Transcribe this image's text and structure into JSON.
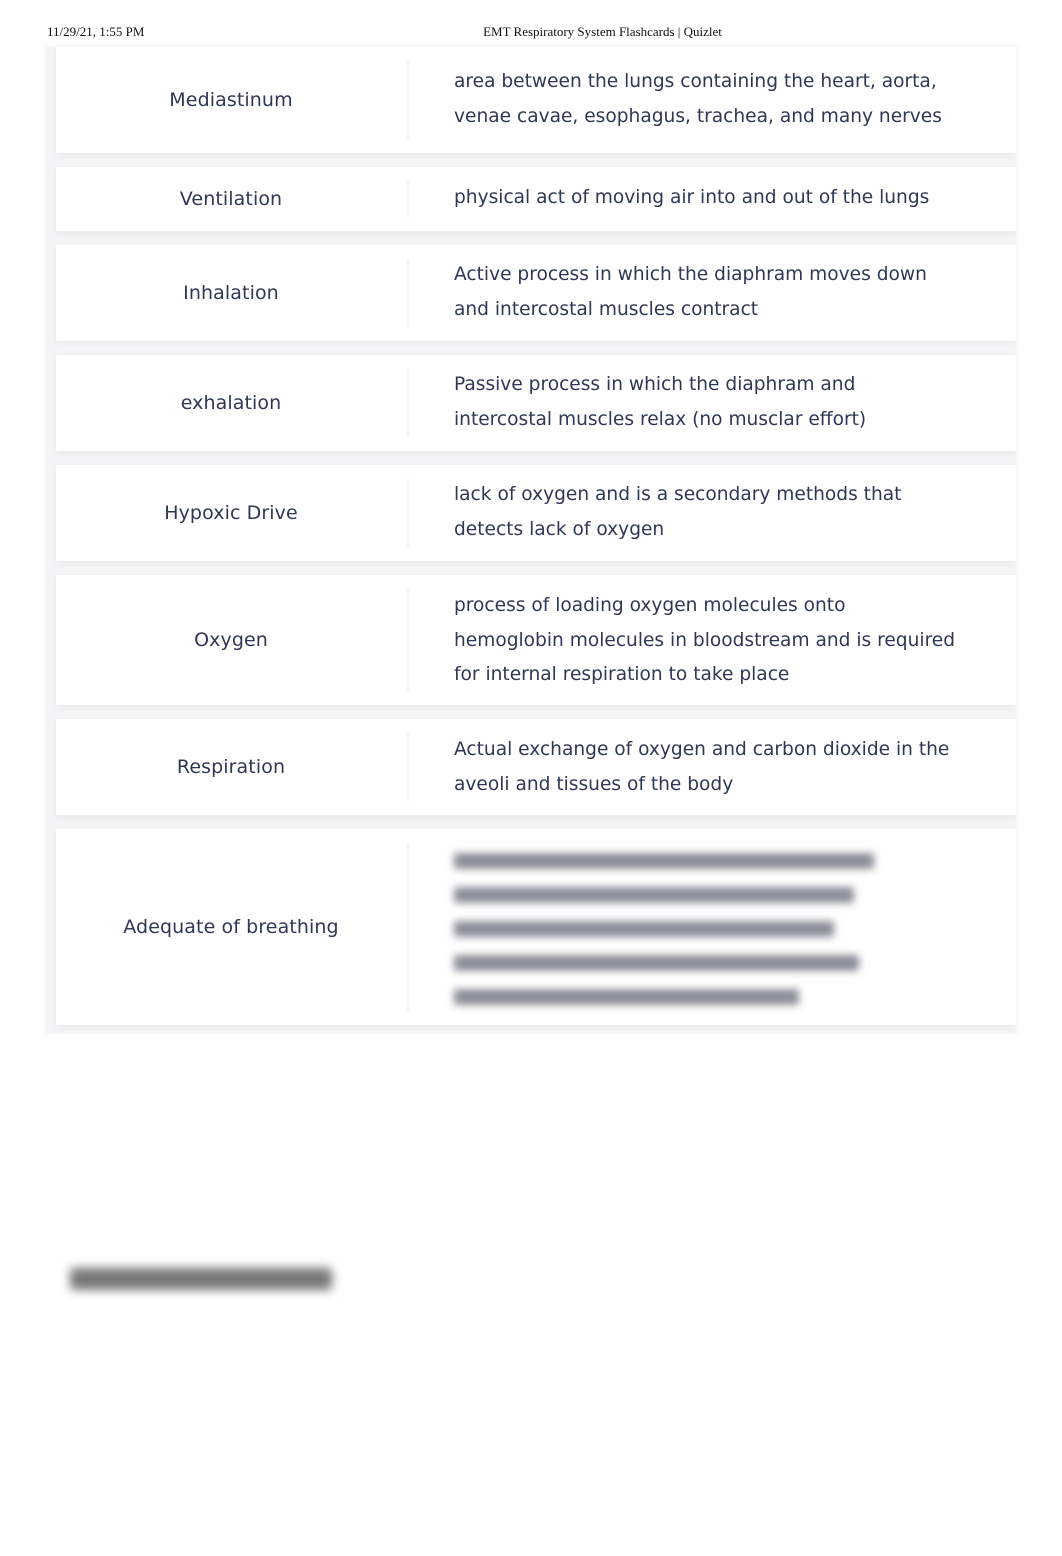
{
  "print_header": {
    "datetime": "11/29/21, 1:55 PM",
    "title": "EMT Respiratory System Flashcards | Quizlet"
  },
  "cards": [
    {
      "term": "Mediastinum",
      "definition": "area between the lungs containing the heart, aorta, venae cavae, esophagus, trachea, and many nerves"
    },
    {
      "term": "Ventilation",
      "definition": "physical act of moving air into and out of the lungs"
    },
    {
      "term": "Inhalation",
      "definition": "Active process in which the diaphram moves down and intercostal muscles contract"
    },
    {
      "term": "exhalation",
      "definition": "Passive process in which the diaphram and intercostal muscles relax (no musclar effort)"
    },
    {
      "term": "Hypoxic Drive",
      "definition": "lack of oxygen and is a secondary methods that detects lack of oxygen"
    },
    {
      "term": "Oxygen",
      "definition": "process of loading oxygen molecules onto hemoglobin molecules in bloodstream and is required for internal respiration to take place"
    },
    {
      "term": "Respiration",
      "definition": "Actual exchange of oxygen and carbon dioxide in the aveoli and tissues of the body"
    },
    {
      "term": "Adequate of breathing",
      "definition": "[blurred]",
      "obscured": true
    }
  ],
  "footer": {
    "blurred_heading": "[blurred]"
  },
  "colors": {
    "text": "#2e3856",
    "separator": "#f3f4f5",
    "card_bg": "#ffffff"
  }
}
